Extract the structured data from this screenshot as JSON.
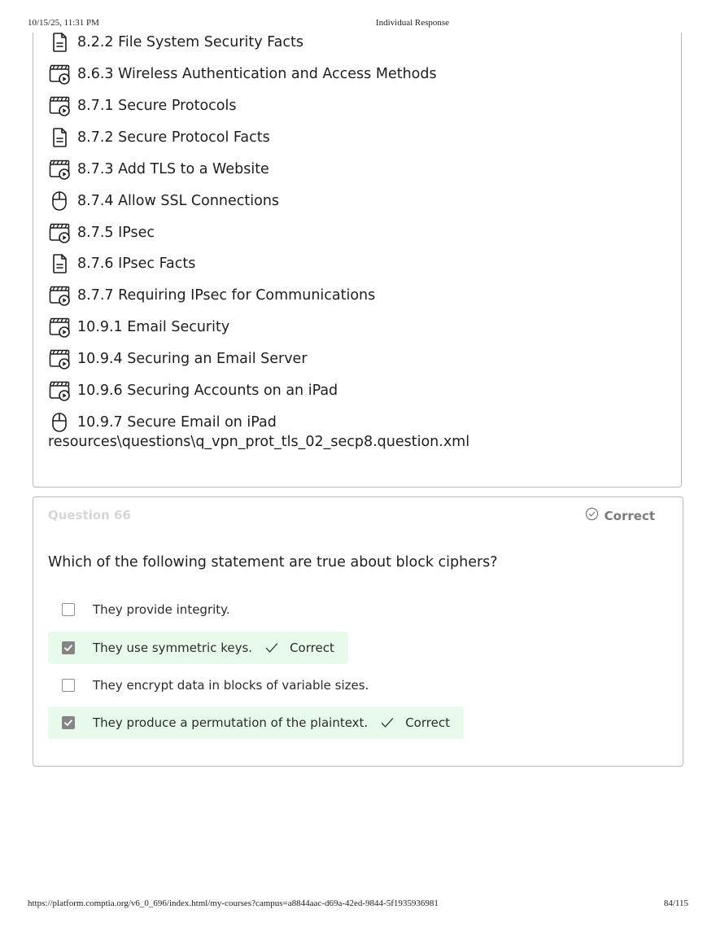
{
  "print_header": {
    "datetime": "10/15/25, 11:31 PM",
    "title": "Individual Response"
  },
  "lessons": [
    {
      "icon": "document-icon",
      "label": "8.2.2 File System Security Facts"
    },
    {
      "icon": "video-icon",
      "label": "8.6.3 Wireless Authentication and Access Methods"
    },
    {
      "icon": "video-icon",
      "label": "8.7.1 Secure Protocols"
    },
    {
      "icon": "document-icon",
      "label": "8.7.2 Secure Protocol Facts"
    },
    {
      "icon": "video-icon",
      "label": "8.7.3 Add TLS to a Website"
    },
    {
      "icon": "mouse-icon",
      "label": "8.7.4 Allow SSL Connections"
    },
    {
      "icon": "video-icon",
      "label": "8.7.5 IPsec"
    },
    {
      "icon": "document-icon",
      "label": "8.7.6 IPsec Facts"
    },
    {
      "icon": "video-icon",
      "label": "8.7.7 Requiring IPsec for Communications"
    },
    {
      "icon": "video-icon",
      "label": "10.9.1 Email Security"
    },
    {
      "icon": "video-icon",
      "label": "10.9.4 Securing an Email Server"
    },
    {
      "icon": "video-icon",
      "label": "10.9.6 Securing Accounts on an iPad"
    },
    {
      "icon": "mouse-icon",
      "label": "10.9.7 Secure Email on iPad"
    }
  ],
  "resource_path": "resources\\questions\\q_vpn_prot_tls_02_secp8.question.xml",
  "question": {
    "number": "Question 66",
    "status": "Correct",
    "text": "Which of the following statement are true about block ciphers?",
    "answers": [
      {
        "label": "They provide integrity.",
        "checked": false,
        "mark": ""
      },
      {
        "label": "They use symmetric keys.",
        "checked": true,
        "mark": "Correct"
      },
      {
        "label": "They encrypt data in blocks of variable sizes.",
        "checked": false,
        "mark": ""
      },
      {
        "label": "They produce a permutation of the plaintext.",
        "checked": true,
        "mark": "Correct"
      }
    ]
  },
  "print_footer": {
    "url": "https://platform.comptia.org/v6_0_696/index.html/my-courses?campus=a8844aac-d69a-42ed-9844-5f1935936981",
    "page": "84/115"
  },
  "colors": {
    "correct_bg": "#e8fbea",
    "checkbox_checked": "#858585",
    "border": "#b9b9b9"
  }
}
